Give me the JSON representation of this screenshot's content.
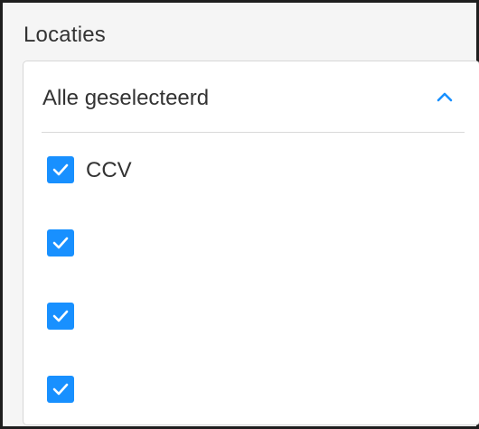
{
  "field": {
    "label": "Locaties"
  },
  "dropdown": {
    "value": "Alle geselecteerd",
    "expanded": true,
    "chevron_icon": "chevron-up-icon",
    "accent_color": "#1890ff"
  },
  "options": [
    {
      "label": "CCV",
      "checked": true
    },
    {
      "label": "",
      "checked": true
    },
    {
      "label": "",
      "checked": true
    },
    {
      "label": "",
      "checked": true
    }
  ]
}
